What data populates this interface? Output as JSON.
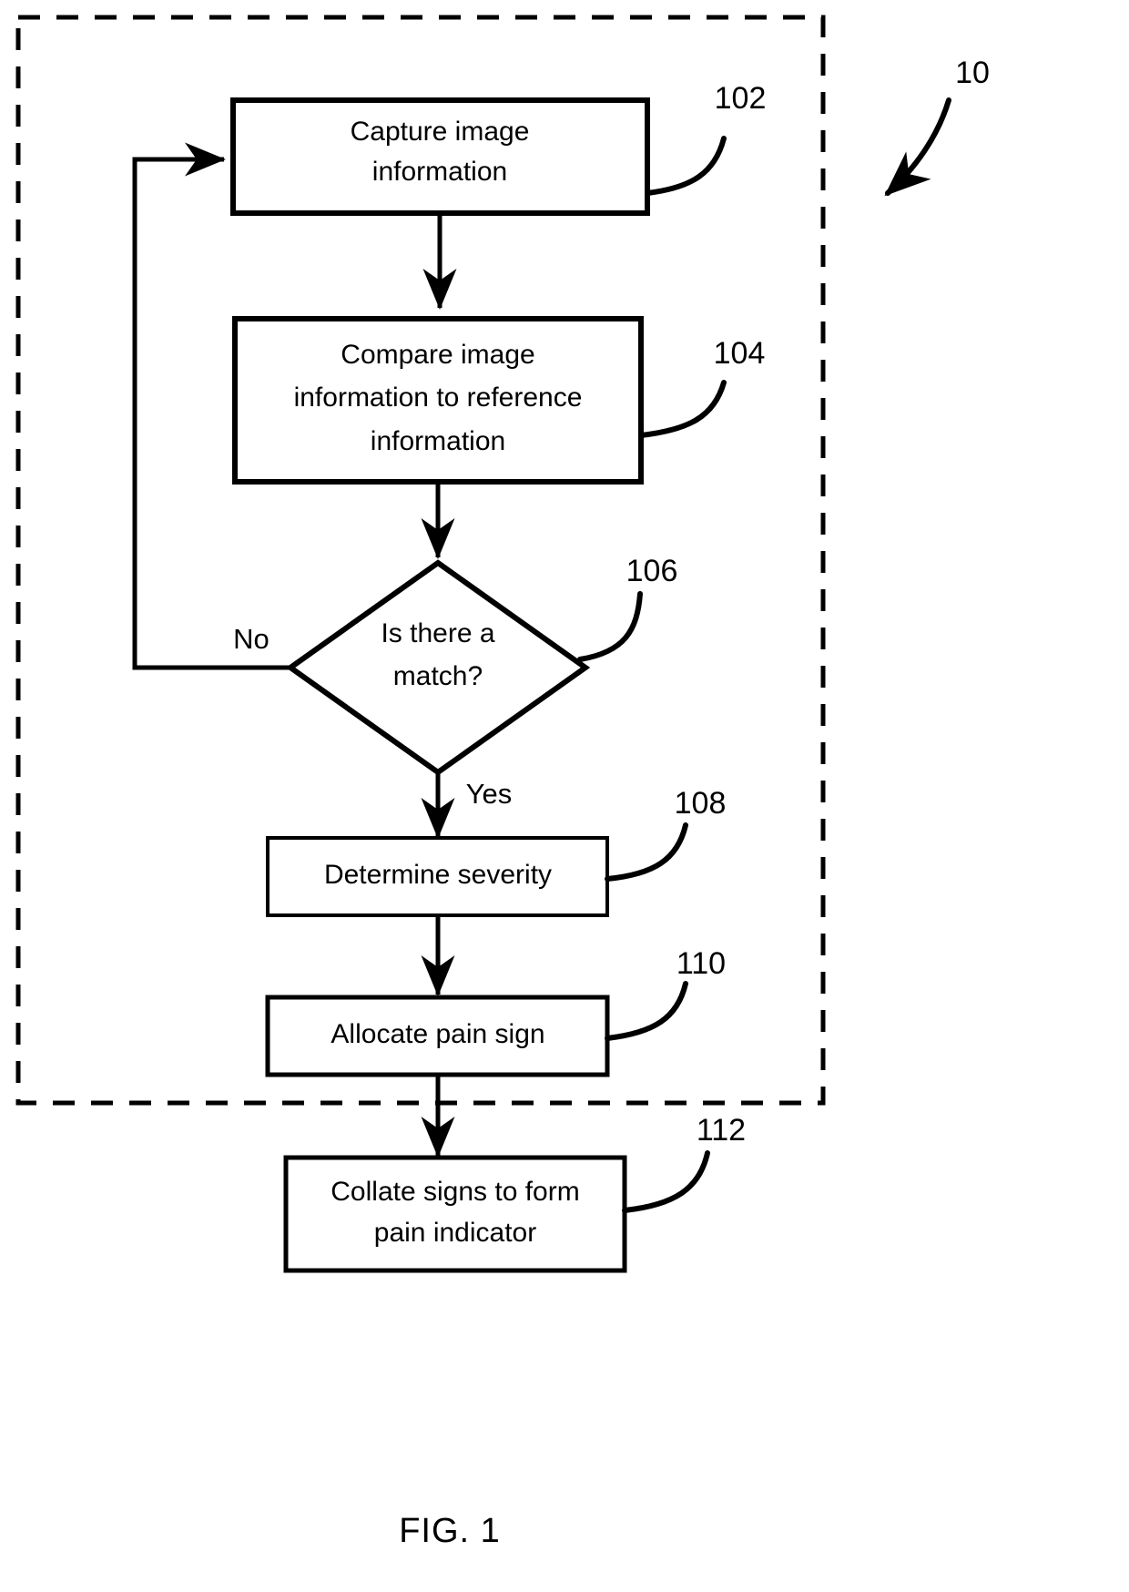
{
  "figure": {
    "caption": "FIG. 1",
    "system_ref": "10",
    "type": "patent-flowchart"
  },
  "boundary": {
    "name": "dashed-system-boundary",
    "style": "dashed"
  },
  "nodes": [
    {
      "id": "capture",
      "ref": "102",
      "shape": "process",
      "lines": [
        "Capture image",
        "information"
      ],
      "text": "Capture image information"
    },
    {
      "id": "compare",
      "ref": "104",
      "shape": "process",
      "lines": [
        "Compare image",
        "information to reference",
        "information"
      ],
      "text": "Compare image information to reference information"
    },
    {
      "id": "match",
      "ref": "106",
      "shape": "decision",
      "lines": [
        "Is there a",
        "match?"
      ],
      "text": "Is there a match?"
    },
    {
      "id": "severity",
      "ref": "108",
      "shape": "process",
      "lines": [
        "Determine severity"
      ],
      "text": "Determine severity"
    },
    {
      "id": "allocate",
      "ref": "110",
      "shape": "process",
      "lines": [
        "Allocate pain sign"
      ],
      "text": "Allocate pain sign"
    },
    {
      "id": "collate",
      "ref": "112",
      "shape": "process",
      "lines": [
        "Collate signs to form",
        "pain indicator"
      ],
      "text": "Collate signs to form pain indicator"
    }
  ],
  "branches": {
    "no_label": "No",
    "yes_label": "Yes"
  },
  "colors": {
    "stroke": "#000000",
    "fill": "#ffffff",
    "background": "#ffffff"
  },
  "chart_data": {
    "type": "diagram",
    "title": "FIG. 1",
    "nodes": [
      {
        "ref": "102",
        "label": "Capture image information",
        "shape": "rect"
      },
      {
        "ref": "104",
        "label": "Compare image information to reference information",
        "shape": "rect"
      },
      {
        "ref": "106",
        "label": "Is there a match?",
        "shape": "diamond"
      },
      {
        "ref": "108",
        "label": "Determine severity",
        "shape": "rect"
      },
      {
        "ref": "110",
        "label": "Allocate pain sign",
        "shape": "rect"
      },
      {
        "ref": "112",
        "label": "Collate signs to form pain indicator",
        "shape": "rect"
      }
    ],
    "edges": [
      {
        "from": "102",
        "to": "104",
        "label": ""
      },
      {
        "from": "104",
        "to": "106",
        "label": ""
      },
      {
        "from": "106",
        "to": "102",
        "label": "No"
      },
      {
        "from": "106",
        "to": "108",
        "label": "Yes"
      },
      {
        "from": "108",
        "to": "110",
        "label": ""
      },
      {
        "from": "110",
        "to": "112",
        "label": ""
      }
    ]
  }
}
